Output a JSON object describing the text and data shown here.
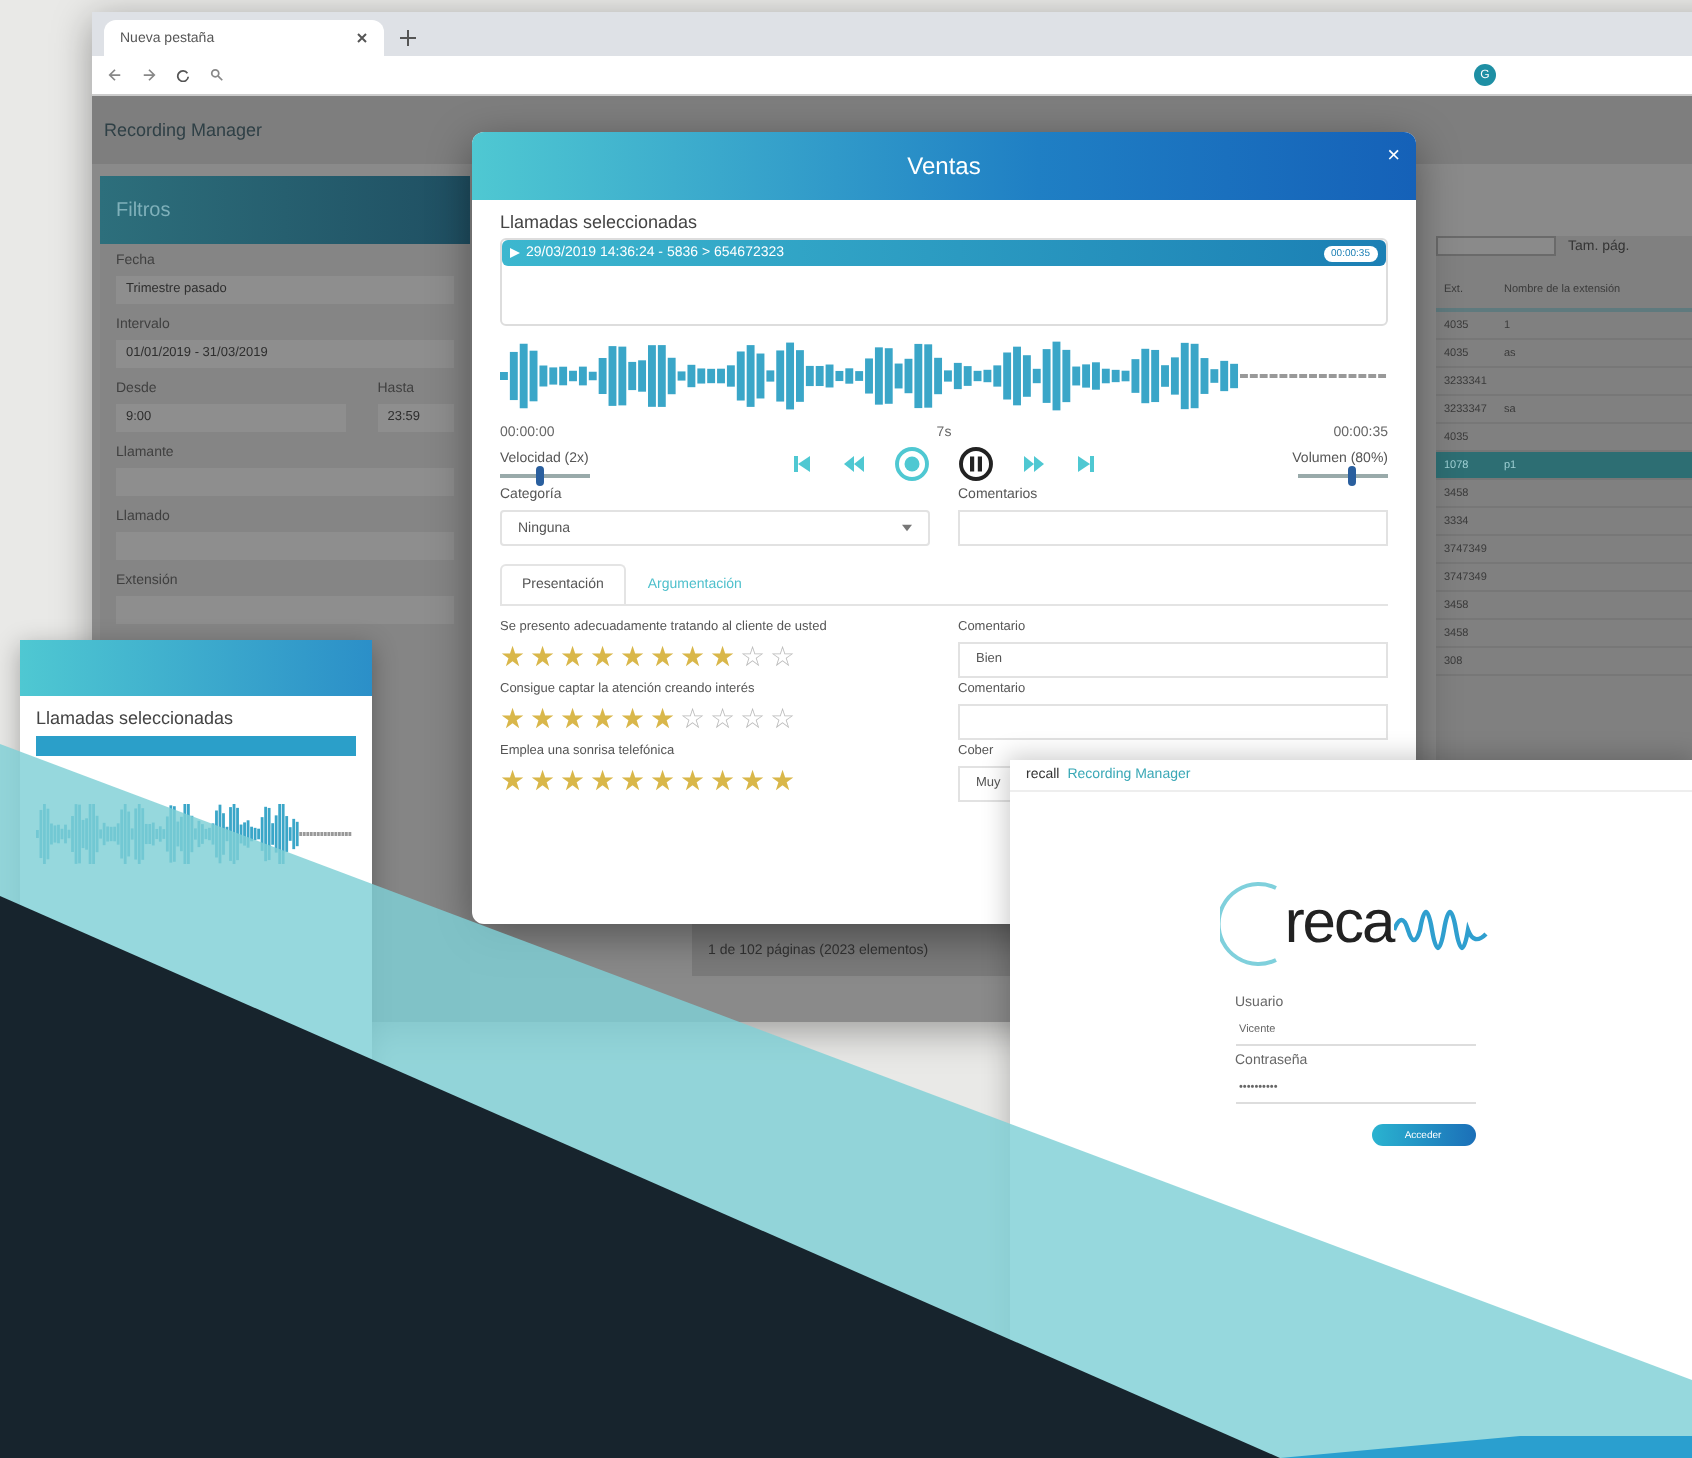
{
  "browser": {
    "tab": "Nueva pestaña",
    "avatar": "G"
  },
  "app": {
    "title": "Recording Manager"
  },
  "filters": {
    "title": "Filtros",
    "fields": [
      {
        "label": "Fecha",
        "value": "Trimestre pasado"
      },
      {
        "label": "Intervalo",
        "value": "01/01/2019 - 31/03/2019"
      },
      {
        "label": "Desde",
        "value": "9:00",
        "label2": "Hasta",
        "value2": "23:59"
      },
      {
        "label": "Llamante"
      },
      {
        "label": "Llamado"
      },
      {
        "label": "Extensión"
      }
    ]
  },
  "table": {
    "page_size_label": "Tam. pág.",
    "columns": [
      "Ext.",
      "Nombre de la extensión"
    ],
    "rows": [
      {
        "cells": [
          "4035",
          "1"
        ],
        "selected": false
      },
      {
        "cells": [
          "4035",
          "as"
        ],
        "selected": false
      },
      {
        "cells": [
          "3233341",
          ""
        ],
        "selected": false
      },
      {
        "cells": [
          "3233347",
          "sa"
        ],
        "selected": false
      },
      {
        "cells": [
          "4035",
          ""
        ],
        "selected": false
      },
      {
        "cells": [
          "1078",
          "p1"
        ],
        "selected": true
      },
      {
        "cells": [
          "3458",
          ""
        ],
        "selected": false
      },
      {
        "cells": [
          "3334",
          ""
        ],
        "selected": false
      },
      {
        "cells": [
          "3747349",
          ""
        ],
        "selected": false
      },
      {
        "cells": [
          "3747349",
          ""
        ],
        "selected": false
      },
      {
        "cells": [
          "3458",
          ""
        ],
        "selected": false
      },
      {
        "cells": [
          "3458",
          ""
        ],
        "selected": false
      },
      {
        "cells": [
          "308",
          ""
        ],
        "selected": false
      }
    ],
    "pagination": "1 de 102 páginas (2023 elementos)"
  },
  "modal": {
    "title": "Ventas",
    "close": "×",
    "section": "Llamadas seleccionadas",
    "call": {
      "text": "29/03/2019 14:36:24 - 5836 > 654672323",
      "duration": "00:00:35"
    },
    "time_start": "00:00:00",
    "time_mid": "7s",
    "time_end": "00:00:35",
    "speed": {
      "label": "Velocidad (2x)",
      "level": 0.4
    },
    "volume": {
      "label": "Volumen (80%)",
      "level": 0.55
    },
    "category": {
      "label": "Categoría",
      "value": "Ninguna"
    },
    "comments_label": "Comentarios",
    "tabs": [
      {
        "label": "Presentación",
        "selected": true
      },
      {
        "label": "Argumentación",
        "selected": false
      }
    ],
    "questions": [
      {
        "text": "Se presento adecuadamente tratando al cliente de usted",
        "stars": 8,
        "comment_label": "Comentario",
        "comment": "Bien"
      },
      {
        "text": "Consigue captar la atención creando interés",
        "stars": 6,
        "comment_label": "Comentario"
      },
      {
        "text": "Emplea una sonrisa telefónica",
        "stars": 10,
        "comment_label": "Cober",
        "comment": "Muy"
      }
    ]
  },
  "side_card": {
    "section": "Llamadas seleccionadas"
  },
  "login": {
    "header_brand": "recall",
    "header_title": "Recording Manager",
    "logo": "reca",
    "user_label": "Usuario",
    "user": "Vicente",
    "password_label": "Contraseña",
    "password": "••••••••••",
    "button": "Acceder"
  }
}
